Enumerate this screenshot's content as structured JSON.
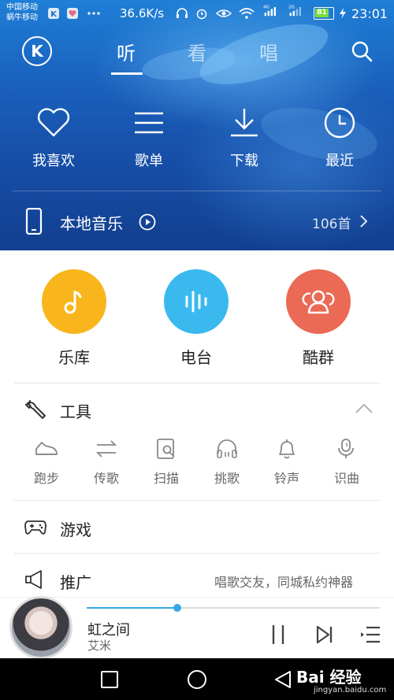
{
  "status_bar": {
    "carrier_1": "中国移动",
    "carrier_2": "蜗牛移动",
    "net_speed": "36.6K/s",
    "signal_1_label": "4G",
    "signal_2_label": "2G",
    "battery": "81",
    "time": "23:01"
  },
  "top_nav": {
    "logo": "K",
    "tabs": [
      "听",
      "看",
      "唱"
    ],
    "active_tab": "听"
  },
  "quick_actions": [
    {
      "label": "我喜欢",
      "icon": "heart-icon"
    },
    {
      "label": "歌单",
      "icon": "list-icon"
    },
    {
      "label": "下载",
      "icon": "download-icon"
    },
    {
      "label": "最近",
      "icon": "clock-icon"
    }
  ],
  "local_music": {
    "title": "本地音乐",
    "count": "106首"
  },
  "features": [
    {
      "label": "乐库",
      "color": "#f8b61c",
      "icon": "music-note-icon"
    },
    {
      "label": "电台",
      "color": "#3ab9ee",
      "icon": "radio-wave-icon"
    },
    {
      "label": "酷群",
      "color": "#ea6a55",
      "icon": "group-icon"
    }
  ],
  "tools": {
    "title": "工具",
    "items": [
      {
        "label": "跑步",
        "icon": "shoe-icon"
      },
      {
        "label": "传歌",
        "icon": "transfer-icon"
      },
      {
        "label": "扫描",
        "icon": "scan-icon"
      },
      {
        "label": "挑歌",
        "icon": "headphones-icon"
      },
      {
        "label": "铃声",
        "icon": "bell-icon"
      },
      {
        "label": "识曲",
        "icon": "mic-recognize-icon"
      }
    ]
  },
  "games": {
    "title": "游戏"
  },
  "promotion": {
    "title": "推广",
    "text": "唱歌交友，同城私约神器"
  },
  "player": {
    "song": "虹之间",
    "artist": "艾米",
    "progress": 0.31
  },
  "watermark": {
    "main": "Bai 经验",
    "sub": "jingyan.baidu.com"
  },
  "colors": {
    "accent": "#35a8e8",
    "hero_top": "#1f7fd6",
    "hero_bottom": "#123f8f"
  }
}
